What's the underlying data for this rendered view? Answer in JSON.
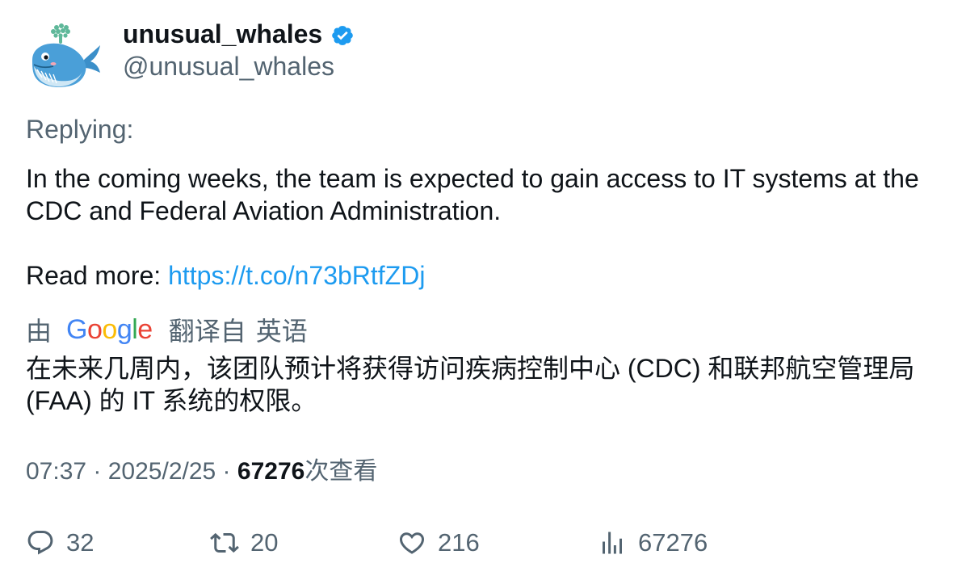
{
  "author": {
    "display_name": "unusual_whales",
    "handle": "@unusual_whales",
    "verified": true,
    "avatar_icon": "whale-icon"
  },
  "tweet": {
    "replying_label": "Replying:",
    "text_line1": "In the coming weeks, the team is expected to gain access to IT systems at the CDC and Federal Aviation Administration.",
    "read_more_label": "Read more: ",
    "link": "https://t.co/n73bRtfZDj"
  },
  "translation": {
    "by_label": "由",
    "provider_letters": [
      "G",
      "o",
      "o",
      "g",
      "l",
      "e"
    ],
    "translated_from_label": "翻译自",
    "source_language": "英语",
    "text": "在未来几周内，该团队预计将获得访问疾病控制中心 (CDC) 和联邦航空管理局 (FAA) 的 IT 系统的权限。"
  },
  "meta": {
    "time": "07:37",
    "separator": " · ",
    "date": "2025/2/25",
    "views_count": "67276",
    "views_label": "次查看"
  },
  "actions": {
    "reply_count": "32",
    "retweet_count": "20",
    "like_count": "216",
    "views_count": "67276"
  },
  "colors": {
    "text_primary": "#0f1419",
    "text_secondary": "#536471",
    "link": "#1d9bf0",
    "verified_badge": "#1d9bf0"
  }
}
